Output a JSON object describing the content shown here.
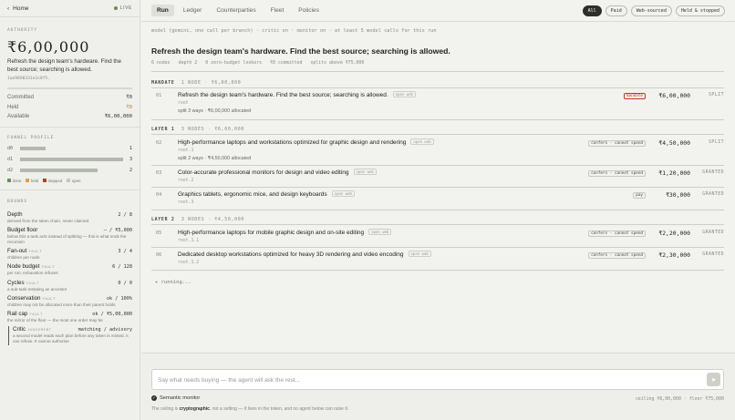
{
  "sidebar": {
    "home": "Home",
    "live": "LIVE",
    "authority_cap": "AUTHORITY",
    "amount": "₹6,00,000",
    "description": "Refresh the design team's hardware. Find the best source; searching is allowed.",
    "hash": "1ae9698331e3c8f5.",
    "committed_label": "Committed",
    "committed_value": "₹0",
    "held_label": "Held",
    "held_value": "₹0",
    "available_label": "Available",
    "available_value": "₹6,00,000",
    "funnel_cap": "FUNNEL PROFILE",
    "funnel": [
      {
        "label": "d0",
        "count": "1",
        "fill": 0.25
      },
      {
        "label": "d1",
        "count": "3",
        "fill": 1
      },
      {
        "label": "d2",
        "count": "2",
        "fill": 0.75
      }
    ],
    "legend": [
      "done",
      "held",
      "stopped",
      "open"
    ],
    "bounds_cap": "BOUNDS",
    "bounds": [
      {
        "label": "Depth",
        "tag": "",
        "value": "2 / 8",
        "sub": "derived from the token chain, never claimed"
      },
      {
        "label": "Budget floor",
        "tag": "",
        "value": "— / ₹5,000",
        "sub": "below this a task acts instead of splitting — this is what ends the recursion"
      },
      {
        "label": "Fan-out",
        "tag": "FAULT",
        "value": "3 / 4",
        "sub": "children per node"
      },
      {
        "label": "Node budget",
        "tag": "FAULT",
        "value": "6 / 128",
        "sub": "per run; exhaustion refuses"
      },
      {
        "label": "Cycles",
        "tag": "FAULT",
        "value": "0 / 0",
        "sub": "a sub-task restating an ancestor"
      },
      {
        "label": "Conservation",
        "tag": "FAULT",
        "value": "ok / 100%",
        "sub": "children may not be allocated more than their parent holds"
      },
      {
        "label": "Rail cap",
        "tag": "FAULT",
        "value": "ok / ₹5,00,000",
        "sub": "the mirror of the floor — the most one order may be"
      }
    ],
    "critic": {
      "label": "Critic",
      "tag": "JUDGEMENT",
      "value": "matching / advisory",
      "sub": "a second model reads each plan before any token is minted. It can refuse. It cannot authorise"
    }
  },
  "tabs": [
    "Run",
    "Ledger",
    "Counterparties",
    "Fleet",
    "Policies"
  ],
  "filters": [
    "All",
    "Paid",
    "Web-sourced",
    "Held & stopped"
  ],
  "run": {
    "meta": "model (gemini, one call per branch) · critic on · monitor on · at least 5 model calls for this run",
    "title": "Refresh the design team's hardware. Find the best source; searching is allowed.",
    "stats": [
      "6 nodes",
      "depth 2",
      "0 zero-budget lookers",
      "₹0 committed",
      "splits above ₹75,000"
    ]
  },
  "levels": [
    {
      "name": "MANDATE",
      "info": "1 NODE · ₹6,00,000"
    },
    {
      "name": "LAYER 1",
      "info": "3 NODES · ₹6,00,000"
    },
    {
      "name": "LAYER 2",
      "info": "3 NODES · ₹4,50,000"
    }
  ],
  "nodes": [
    {
      "id": "01",
      "title": "Refresh the design team's hardware. Find the best source; searching is allowed.",
      "badge": "open web",
      "sub": "root",
      "split": "split 3 ways · ₹6,00,000 allocated",
      "chip": "mandate",
      "amount": "₹6,00,000",
      "status": "SPLIT"
    },
    {
      "id": "02",
      "title": "High-performance laptops and workstations optimized for graphic design and rendering",
      "badge": "open web",
      "sub": "root.1",
      "split": "split 2 ways · ₹4,50,000 allocated",
      "chip": "confers · cannot spend",
      "amount": "₹4,50,000",
      "status": "SPLIT"
    },
    {
      "id": "03",
      "title": "Color-accurate professional monitors for design and video editing",
      "badge": "open web",
      "sub": "root.2",
      "split": "",
      "chip": "confers · cannot spend",
      "amount": "₹1,20,000",
      "status": "GRANTED"
    },
    {
      "id": "04",
      "title": "Graphics tablets, ergonomic mice, and design keyboards",
      "badge": "open web",
      "sub": "root.3",
      "split": "",
      "chip": "pay",
      "amount": "₹30,000",
      "status": "GRANTED"
    },
    {
      "id": "05",
      "title": "High-performance laptops for mobile graphic design and on-site editing",
      "badge": "open web",
      "sub": "root.1.1",
      "split": "",
      "chip": "confers · cannot spend",
      "amount": "₹2,20,000",
      "status": "GRANTED"
    },
    {
      "id": "06",
      "title": "Dedicated desktop workstations optimized for heavy 3D rendering and video encoding",
      "badge": "open web",
      "sub": "root.1.2",
      "split": "",
      "chip": "confers · cannot spend",
      "amount": "₹2,30,000",
      "status": "GRANTED"
    }
  ],
  "running": "running...",
  "composer": {
    "placeholder": "Say what needs buying — the agent will ask the rest...",
    "monitor": "Semantic monitor",
    "ceiling": "ceiling ₹6,00,000 · floor ₹75,000",
    "note_pre": "The ceiling is ",
    "note_bold": "cryptographic",
    "note_post": ", not a setting — it lives in the token, and no agent below can raise it."
  },
  "colors": {
    "done": "#6b8e60",
    "held": "#d4a24c",
    "stopped": "#c0392b",
    "open": "#c8c8c0"
  }
}
